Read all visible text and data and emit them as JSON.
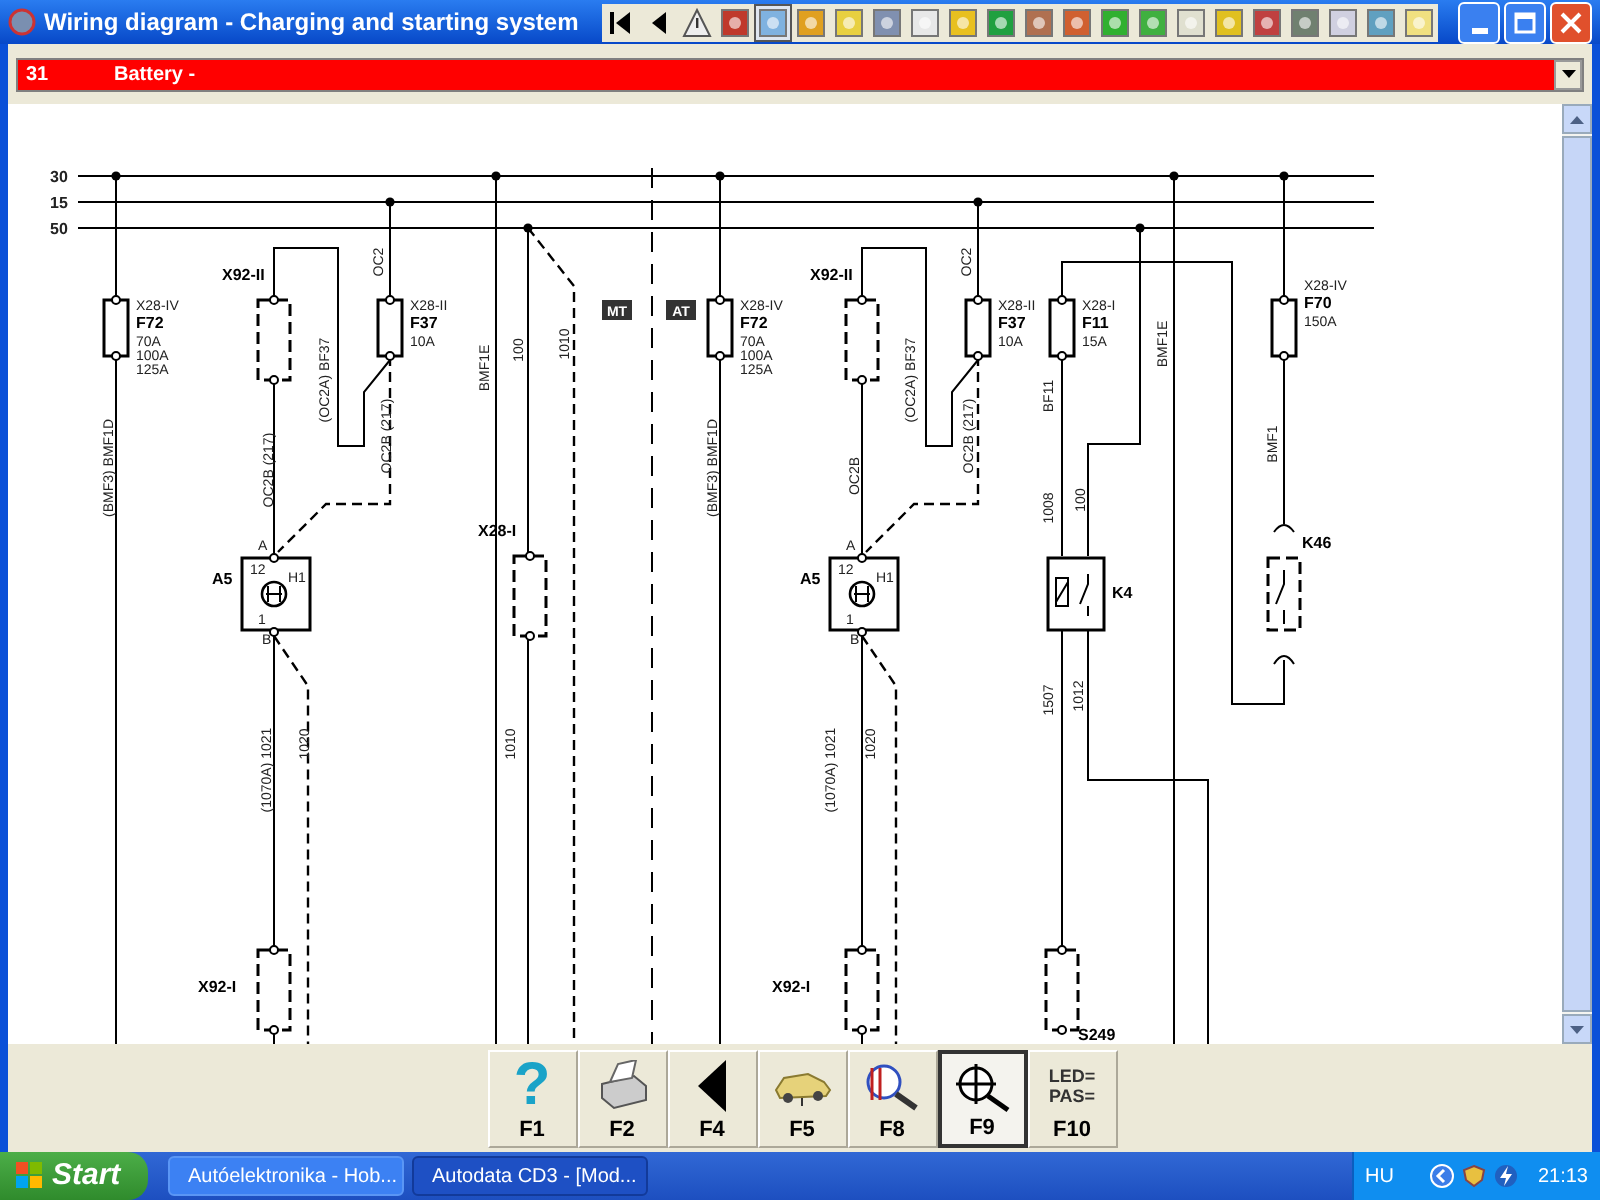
{
  "window": {
    "title": "Wiring diagram - Charging and starting system"
  },
  "toolbar": [
    {
      "selected": false
    },
    {
      "selected": false
    },
    {
      "selected": false
    },
    {
      "selected": false
    },
    {
      "selected": true
    },
    {
      "selected": false
    },
    {
      "selected": false
    },
    {
      "selected": false
    },
    {
      "selected": false
    },
    {
      "selected": false
    },
    {
      "selected": false
    },
    {
      "selected": false
    },
    {
      "selected": false
    },
    {
      "selected": false
    },
    {
      "selected": false
    },
    {
      "selected": false
    },
    {
      "selected": false
    },
    {
      "selected": false
    },
    {
      "selected": false
    },
    {
      "selected": false
    },
    {
      "selected": false
    },
    {
      "selected": false
    }
  ],
  "circuit_select": {
    "code": "31",
    "name": "Battery -"
  },
  "diagram": {
    "buses": [
      {
        "label": "30"
      },
      {
        "label": "15"
      },
      {
        "label": "50"
      }
    ],
    "mode_tags": [
      {
        "label": "MT"
      },
      {
        "label": "AT"
      }
    ],
    "fuses": [
      {
        "connector": "X28-IV",
        "ref": "F72",
        "ratings": [
          "70A",
          "100A",
          "125A"
        ]
      },
      {
        "connector": "X28-II",
        "ref": "F37",
        "ratings": [
          "10A"
        ]
      },
      {
        "connector": "X28-IV",
        "ref": "F72",
        "ratings": [
          "70A",
          "100A",
          "125A"
        ]
      },
      {
        "connector": "X28-II",
        "ref": "F37",
        "ratings": [
          "10A"
        ]
      },
      {
        "connector": "X28-I",
        "ref": "F11",
        "ratings": [
          "15A"
        ]
      },
      {
        "connector": "X28-IV",
        "ref": "F70",
        "ratings": [
          "150A"
        ]
      }
    ],
    "components": [
      {
        "kind": "lamp",
        "ref": "A5",
        "pins": [
          "A",
          "12",
          "H1",
          "1",
          "B"
        ]
      },
      {
        "kind": "lamp",
        "ref": "A5",
        "pins": [
          "A",
          "12",
          "H1",
          "1",
          "B"
        ]
      },
      {
        "kind": "relay",
        "ref": "K4"
      },
      {
        "kind": "switch",
        "ref": "K46"
      }
    ],
    "connectors": [
      {
        "ref": "X92-II"
      },
      {
        "ref": "X28-I"
      },
      {
        "ref": "X92-I"
      },
      {
        "ref": "X92-II"
      },
      {
        "ref": "X92-I"
      },
      {
        "ref": "S249"
      }
    ],
    "wire_labels": [
      "(BMF3) BMF1D",
      "(OC2A) BF37",
      "OC2",
      "OC2B (217)",
      "OC2B (217)",
      "BMF1E",
      "100",
      "1010",
      "(1070A) 1021",
      "1020",
      "1010",
      "(BMF3) BMF1D",
      "(OC2A) BF37",
      "OC2",
      "OC2B",
      "OC2B (217)",
      "BF11",
      "BMF1E",
      "1008",
      "100",
      "BMF1",
      "(1070A) 1021",
      "1020",
      "1507",
      "1012"
    ]
  },
  "function_keys": [
    {
      "label": "F1",
      "kind": "help",
      "glyph": "?",
      "selected": false
    },
    {
      "label": "F2",
      "kind": "printer",
      "selected": false
    },
    {
      "label": "F4",
      "kind": "back",
      "selected": false
    },
    {
      "label": "F5",
      "kind": "car",
      "selected": false
    },
    {
      "label": "F8",
      "kind": "zoom",
      "selected": false
    },
    {
      "label": "F9",
      "kind": "probe",
      "selected": true
    },
    {
      "label": "F10",
      "kind": "text",
      "lines": [
        "LED=",
        "PAS="
      ],
      "selected": false
    }
  ],
  "taskbar": {
    "start": "Start",
    "tasks": [
      {
        "label": "Autóelektronika - Hob...",
        "selected": false
      },
      {
        "label": "Autodata CD3 - [Mod...",
        "selected": true
      }
    ],
    "language": "HU",
    "clock": "21:13"
  }
}
